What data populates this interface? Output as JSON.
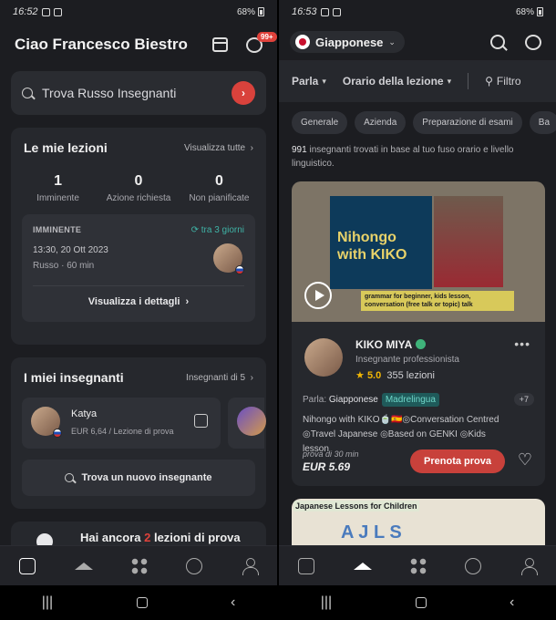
{
  "left": {
    "status": {
      "time": "16:52",
      "battery": "68%"
    },
    "header": {
      "greeting": "Ciao Francesco Biestro",
      "chat_badge": "99+"
    },
    "search": {
      "placeholder": "Trova Russo Insegnanti"
    },
    "lessons": {
      "title": "Le mie lezioni",
      "view_all": "Visualizza tutte",
      "stats": [
        {
          "num": "1",
          "label": "Imminente"
        },
        {
          "num": "0",
          "label": "Azione richiesta"
        },
        {
          "num": "0",
          "label": "Non pianificate"
        }
      ],
      "upcoming": {
        "label": "IMMINENTE",
        "when": "tra 3 giorni",
        "date": "13:30, 20 Ott 2023",
        "sub": "Russo · 60 min",
        "details": "Visualizza i dettagli"
      }
    },
    "teachers": {
      "title": "I miei insegnanti",
      "count_link": "Insegnanti di 5",
      "items": [
        {
          "name": "Katya",
          "price": "EUR 6,64 / Lezione di prova"
        }
      ],
      "find": "Trova un nuovo insegnante"
    },
    "trial": {
      "prefix": "Hai ancora",
      "count": "2",
      "suffix": "lezioni di prova"
    }
  },
  "right": {
    "status": {
      "time": "16:53",
      "battery": "68%"
    },
    "language": "Giapponese",
    "filters": {
      "speaks": "Parla",
      "time": "Orario della lezione",
      "filter": "Filtro"
    },
    "chips": [
      "Generale",
      "Azienda",
      "Preparazione di esami",
      "Ba"
    ],
    "results": {
      "count": "991",
      "text": "insegnanti trovati in base al tuo fuso orario e livello linguistico."
    },
    "teacher": {
      "video_title": "Nihongo with KIKO",
      "video_caption": "grammar for beginner, kids lesson, conversation (free talk or topic) talk",
      "name": "KIKO MIYA",
      "role": "Insegnante professionista",
      "rating": "5.0",
      "lessons": "355 lezioni",
      "speaks_label": "Parla:",
      "speaks_lang": "Giapponese",
      "native": "Madrelingua",
      "more_langs": "+7",
      "desc": "Nihongo with KIKO🍵🇪🇸◎Conversation Centred ◎Travel Japanese ◎Based on GENKI ◎Kids lesson",
      "trial_label": "prova di 30 min",
      "trial_price": "EUR 5.69",
      "book": "Prenota prova"
    },
    "next_card": {
      "banner": "Japanese Lessons for Children",
      "logo": "A J L S"
    }
  }
}
